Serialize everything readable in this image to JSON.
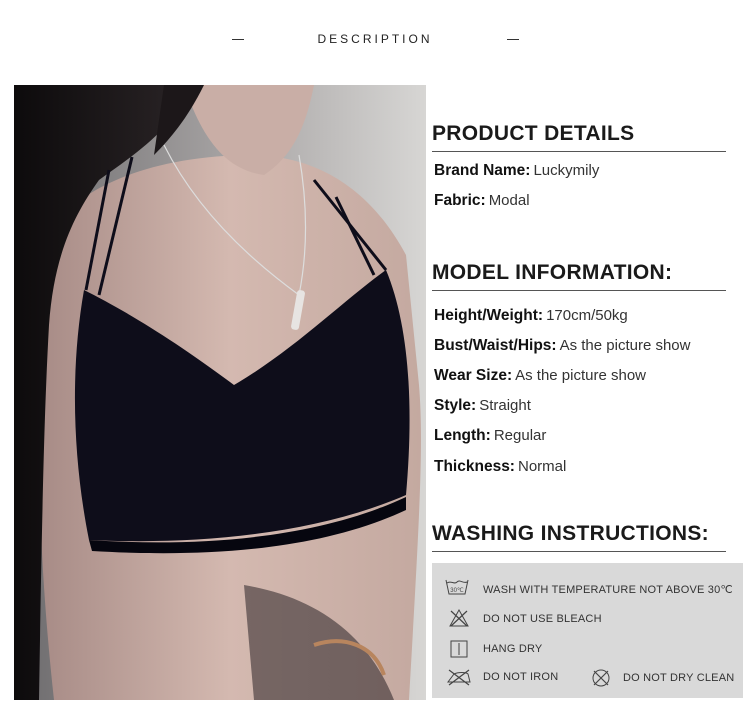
{
  "header": {
    "title": "DESCRIPTION"
  },
  "product_details": {
    "title": "PRODUCT DETAILS",
    "items": [
      {
        "label": "Brand Name:",
        "value": "Luckymily"
      },
      {
        "label": "Fabric:",
        "value": "Modal"
      }
    ]
  },
  "model_information": {
    "title": "MODEL INFORMATION:",
    "items": [
      {
        "label": "Height/Weight:",
        "value": "170cm/50kg"
      },
      {
        "label": "Bust/Waist/Hips:",
        "value": "As the picture show"
      },
      {
        "label": "Wear Size:",
        "value": "As the picture show"
      },
      {
        "label": "Style:",
        "value": "Straight"
      },
      {
        "label": "Length:",
        "value": "Regular"
      },
      {
        "label": "Thickness:",
        "value": "Normal"
      }
    ]
  },
  "washing": {
    "title": "WASHING INSTRUCTIONS:",
    "items": [
      {
        "icon": "wash-30-icon",
        "icon_text": "30℃",
        "text": "WASH WITH TEMPERATURE NOT ABOVE 30℃"
      },
      {
        "icon": "no-bleach-icon",
        "text": "DO NOT USE BLEACH"
      },
      {
        "icon": "hang-dry-icon",
        "text": "HANG DRY"
      },
      {
        "icon": "no-iron-icon",
        "text": "DO NOT IRON"
      },
      {
        "icon": "no-dry-clean-icon",
        "text": "DO NOT DRY CLEAN"
      }
    ],
    "background": "#d9d9d9"
  }
}
